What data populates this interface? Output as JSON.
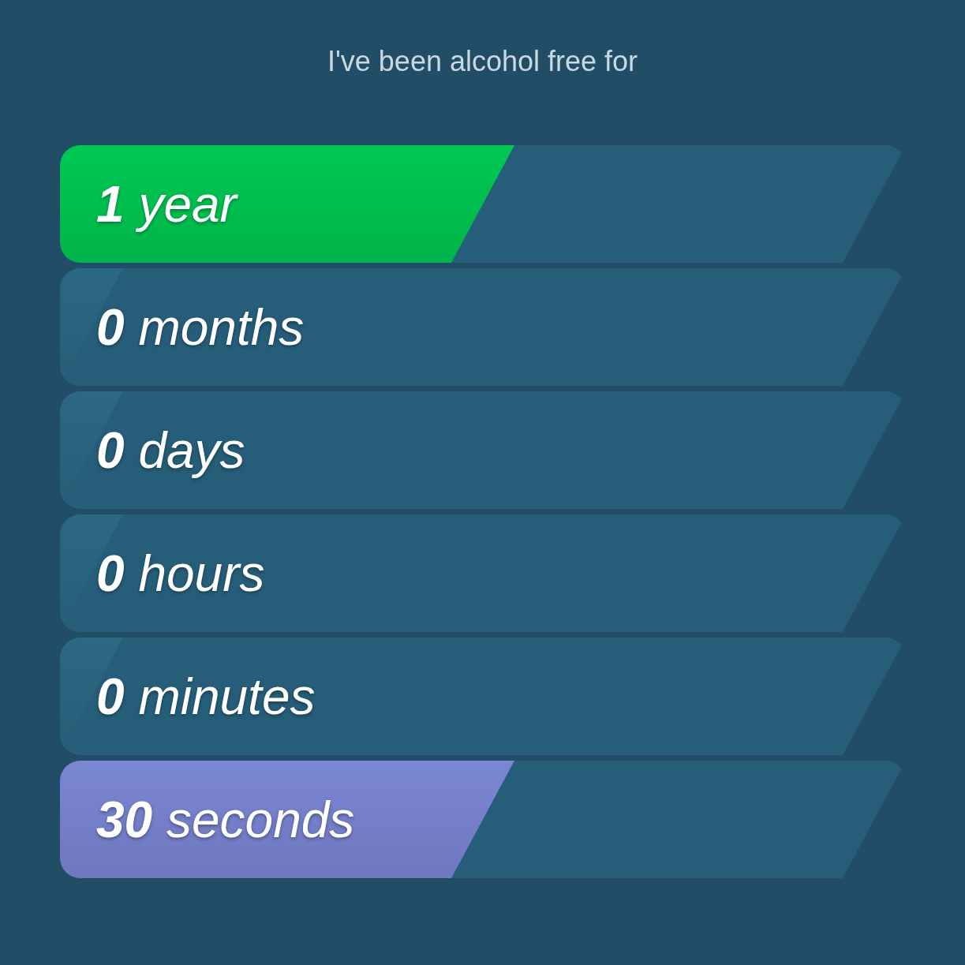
{
  "title": "I've been alcohol free for",
  "counters": [
    {
      "text": "**1** year",
      "level": 0.5,
      "color": "#00c853"
    },
    {
      "text": "**0** months",
      "level": 0
    },
    {
      "text": "**0** days",
      "level": 0
    },
    {
      "text": "**0** hours",
      "level": 0
    },
    {
      "text": "**0** minutes",
      "level": 0
    },
    {
      "text": "**30** seconds",
      "level": 0.5,
      "color": "#7b86d4"
    }
  ]
}
